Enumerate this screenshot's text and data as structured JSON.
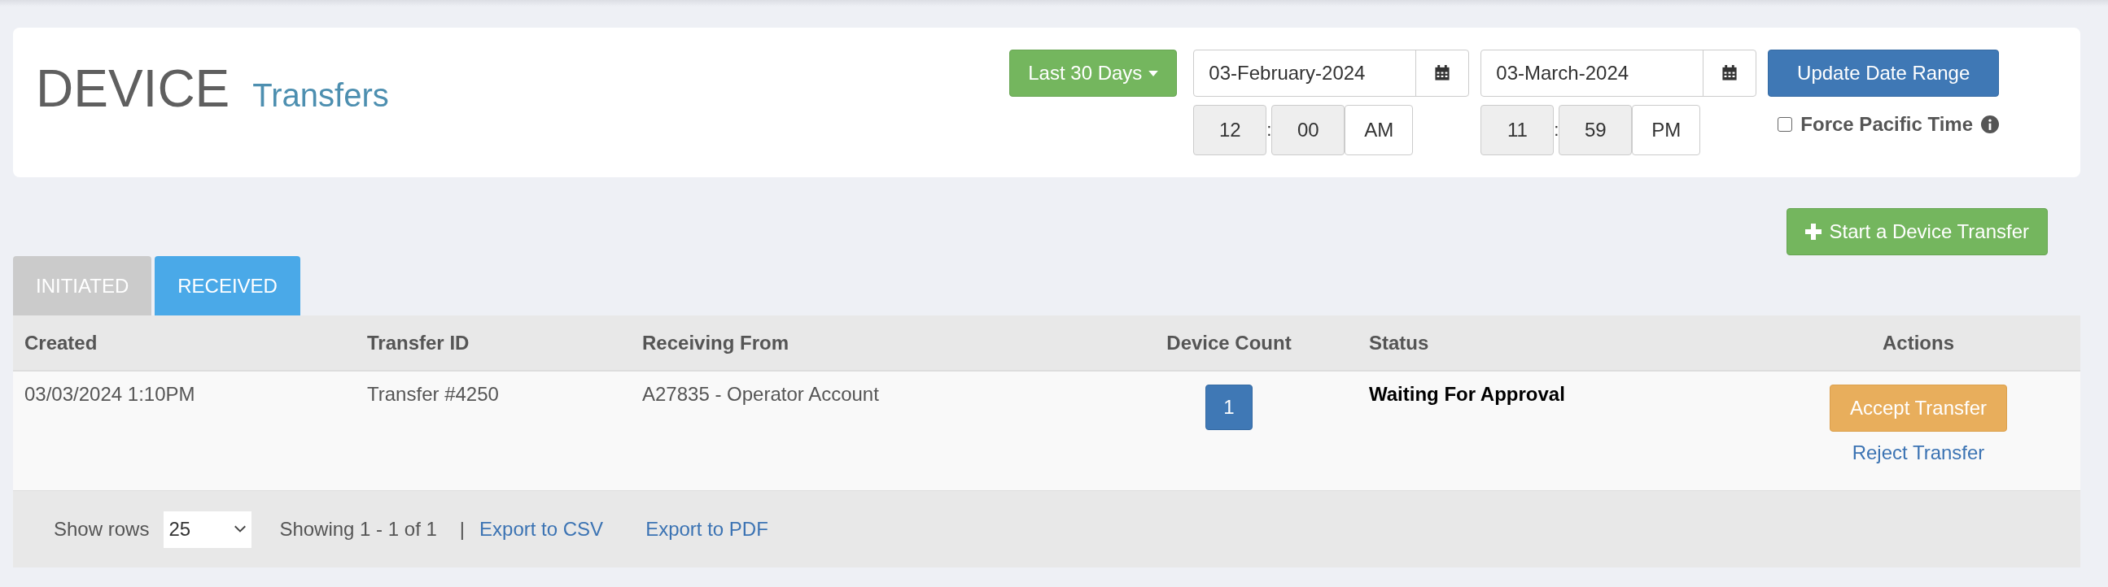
{
  "header": {
    "title": "DEVICE",
    "subtitle": "Transfers"
  },
  "date_range": {
    "preset": "Last 30 Days",
    "start_date": "03-February-2024",
    "end_date": "03-March-2024",
    "start_time": {
      "hour": "12",
      "separator": ":",
      "minute": "00",
      "period": "AM"
    },
    "end_time": {
      "hour": "11",
      "separator": ":",
      "minute": "59",
      "period": "PM"
    },
    "update_button": "Update Date Range",
    "force_pacific_time": {
      "label": "Force Pacific Time",
      "checked": false
    }
  },
  "start_transfer_button": "Start a Device Transfer",
  "tabs": [
    {
      "label": "INITIATED",
      "selected": false
    },
    {
      "label": "RECEIVED",
      "selected": true
    }
  ],
  "table": {
    "columns": [
      "Created",
      "Transfer ID",
      "Receiving From",
      "Device Count",
      "Status",
      "Actions"
    ],
    "rows": [
      {
        "created": "03/03/2024 1:10PM",
        "transfer_id": "Transfer #4250",
        "receiving_from": "A27835 - Operator Account",
        "device_count": "1",
        "status": "Waiting For Approval",
        "actions": [
          {
            "kind": "button",
            "label": "Accept Transfer"
          },
          {
            "kind": "link",
            "label": "Reject Transfer"
          }
        ]
      }
    ]
  },
  "footer": {
    "show_rows_label": "Show rows",
    "rows_per_page": "25",
    "summary": "Showing 1 - 1 of 1",
    "separator": "|",
    "links": [
      "Export to CSV",
      "Export to PDF"
    ]
  }
}
